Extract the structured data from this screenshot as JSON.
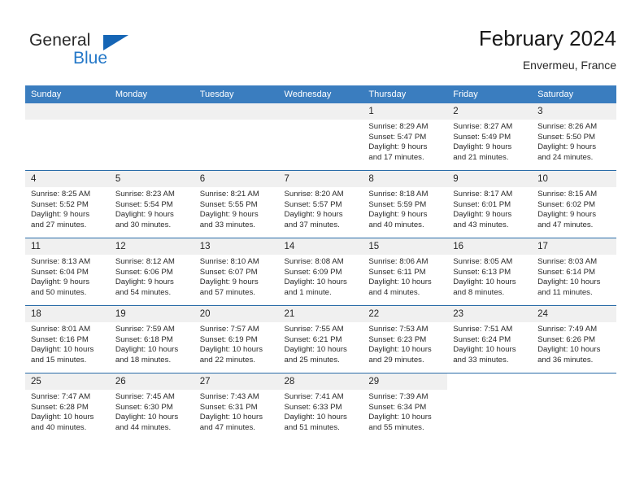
{
  "brand": {
    "line1": "General",
    "line2": "Blue",
    "triangle_color": "#1565b5",
    "blue_color": "#2478c8"
  },
  "header": {
    "title": "February 2024",
    "subtitle": "Envermeu, France",
    "accent_color": "#3a7dbf",
    "separator_color": "#2a6ca8",
    "daynum_band_color": "#f0f0f0"
  },
  "weekdays": [
    "Sunday",
    "Monday",
    "Tuesday",
    "Wednesday",
    "Thursday",
    "Friday",
    "Saturday"
  ],
  "weeks": [
    [
      {
        "day": "",
        "blank": true,
        "lines": []
      },
      {
        "day": "",
        "blank": true,
        "lines": []
      },
      {
        "day": "",
        "blank": true,
        "lines": []
      },
      {
        "day": "",
        "blank": true,
        "lines": []
      },
      {
        "day": "1",
        "lines": [
          "Sunrise: 8:29 AM",
          "Sunset: 5:47 PM",
          "Daylight: 9 hours",
          "and 17 minutes."
        ]
      },
      {
        "day": "2",
        "lines": [
          "Sunrise: 8:27 AM",
          "Sunset: 5:49 PM",
          "Daylight: 9 hours",
          "and 21 minutes."
        ]
      },
      {
        "day": "3",
        "lines": [
          "Sunrise: 8:26 AM",
          "Sunset: 5:50 PM",
          "Daylight: 9 hours",
          "and 24 minutes."
        ]
      }
    ],
    [
      {
        "day": "4",
        "lines": [
          "Sunrise: 8:25 AM",
          "Sunset: 5:52 PM",
          "Daylight: 9 hours",
          "and 27 minutes."
        ]
      },
      {
        "day": "5",
        "lines": [
          "Sunrise: 8:23 AM",
          "Sunset: 5:54 PM",
          "Daylight: 9 hours",
          "and 30 minutes."
        ]
      },
      {
        "day": "6",
        "lines": [
          "Sunrise: 8:21 AM",
          "Sunset: 5:55 PM",
          "Daylight: 9 hours",
          "and 33 minutes."
        ]
      },
      {
        "day": "7",
        "lines": [
          "Sunrise: 8:20 AM",
          "Sunset: 5:57 PM",
          "Daylight: 9 hours",
          "and 37 minutes."
        ]
      },
      {
        "day": "8",
        "lines": [
          "Sunrise: 8:18 AM",
          "Sunset: 5:59 PM",
          "Daylight: 9 hours",
          "and 40 minutes."
        ]
      },
      {
        "day": "9",
        "lines": [
          "Sunrise: 8:17 AM",
          "Sunset: 6:01 PM",
          "Daylight: 9 hours",
          "and 43 minutes."
        ]
      },
      {
        "day": "10",
        "lines": [
          "Sunrise: 8:15 AM",
          "Sunset: 6:02 PM",
          "Daylight: 9 hours",
          "and 47 minutes."
        ]
      }
    ],
    [
      {
        "day": "11",
        "lines": [
          "Sunrise: 8:13 AM",
          "Sunset: 6:04 PM",
          "Daylight: 9 hours",
          "and 50 minutes."
        ]
      },
      {
        "day": "12",
        "lines": [
          "Sunrise: 8:12 AM",
          "Sunset: 6:06 PM",
          "Daylight: 9 hours",
          "and 54 minutes."
        ]
      },
      {
        "day": "13",
        "lines": [
          "Sunrise: 8:10 AM",
          "Sunset: 6:07 PM",
          "Daylight: 9 hours",
          "and 57 minutes."
        ]
      },
      {
        "day": "14",
        "lines": [
          "Sunrise: 8:08 AM",
          "Sunset: 6:09 PM",
          "Daylight: 10 hours",
          "and 1 minute."
        ]
      },
      {
        "day": "15",
        "lines": [
          "Sunrise: 8:06 AM",
          "Sunset: 6:11 PM",
          "Daylight: 10 hours",
          "and 4 minutes."
        ]
      },
      {
        "day": "16",
        "lines": [
          "Sunrise: 8:05 AM",
          "Sunset: 6:13 PM",
          "Daylight: 10 hours",
          "and 8 minutes."
        ]
      },
      {
        "day": "17",
        "lines": [
          "Sunrise: 8:03 AM",
          "Sunset: 6:14 PM",
          "Daylight: 10 hours",
          "and 11 minutes."
        ]
      }
    ],
    [
      {
        "day": "18",
        "lines": [
          "Sunrise: 8:01 AM",
          "Sunset: 6:16 PM",
          "Daylight: 10 hours",
          "and 15 minutes."
        ]
      },
      {
        "day": "19",
        "lines": [
          "Sunrise: 7:59 AM",
          "Sunset: 6:18 PM",
          "Daylight: 10 hours",
          "and 18 minutes."
        ]
      },
      {
        "day": "20",
        "lines": [
          "Sunrise: 7:57 AM",
          "Sunset: 6:19 PM",
          "Daylight: 10 hours",
          "and 22 minutes."
        ]
      },
      {
        "day": "21",
        "lines": [
          "Sunrise: 7:55 AM",
          "Sunset: 6:21 PM",
          "Daylight: 10 hours",
          "and 25 minutes."
        ]
      },
      {
        "day": "22",
        "lines": [
          "Sunrise: 7:53 AM",
          "Sunset: 6:23 PM",
          "Daylight: 10 hours",
          "and 29 minutes."
        ]
      },
      {
        "day": "23",
        "lines": [
          "Sunrise: 7:51 AM",
          "Sunset: 6:24 PM",
          "Daylight: 10 hours",
          "and 33 minutes."
        ]
      },
      {
        "day": "24",
        "lines": [
          "Sunrise: 7:49 AM",
          "Sunset: 6:26 PM",
          "Daylight: 10 hours",
          "and 36 minutes."
        ]
      }
    ],
    [
      {
        "day": "25",
        "lines": [
          "Sunrise: 7:47 AM",
          "Sunset: 6:28 PM",
          "Daylight: 10 hours",
          "and 40 minutes."
        ]
      },
      {
        "day": "26",
        "lines": [
          "Sunrise: 7:45 AM",
          "Sunset: 6:30 PM",
          "Daylight: 10 hours",
          "and 44 minutes."
        ]
      },
      {
        "day": "27",
        "lines": [
          "Sunrise: 7:43 AM",
          "Sunset: 6:31 PM",
          "Daylight: 10 hours",
          "and 47 minutes."
        ]
      },
      {
        "day": "28",
        "lines": [
          "Sunrise: 7:41 AM",
          "Sunset: 6:33 PM",
          "Daylight: 10 hours",
          "and 51 minutes."
        ]
      },
      {
        "day": "29",
        "lines": [
          "Sunrise: 7:39 AM",
          "Sunset: 6:34 PM",
          "Daylight: 10 hours",
          "and 55 minutes."
        ]
      },
      {
        "day": "",
        "blank": true,
        "lines": []
      },
      {
        "day": "",
        "blank": true,
        "lines": []
      }
    ]
  ]
}
